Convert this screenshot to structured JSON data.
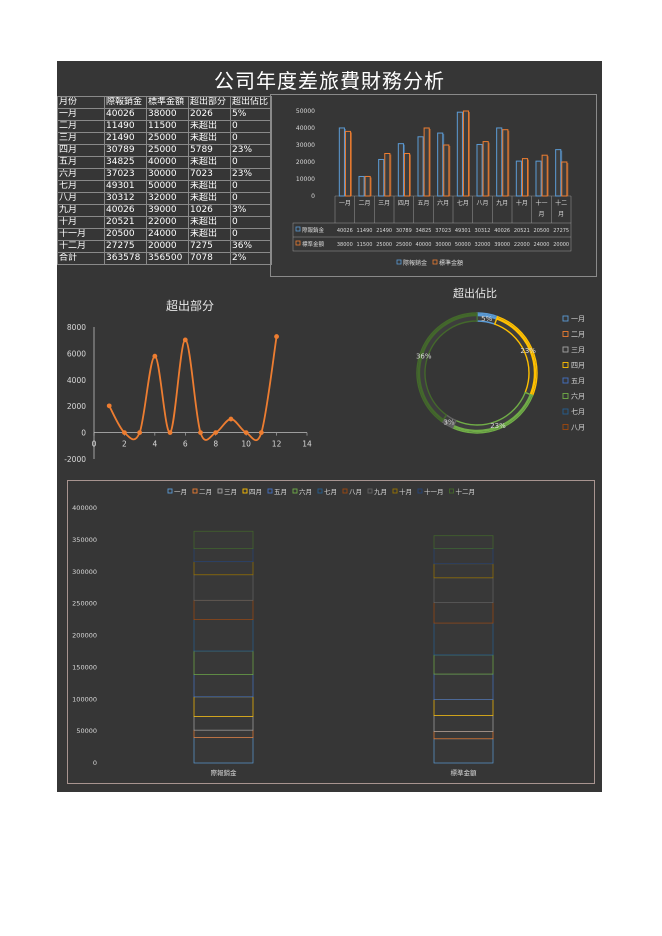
{
  "title": "公司年度差旅費財務分析",
  "table": {
    "headers": [
      "月份",
      "際報銷金",
      "標準金額",
      "超出部分",
      "超出佔比"
    ],
    "rows": [
      [
        "一月",
        "40026",
        "38000",
        "2026",
        "5%"
      ],
      [
        "二月",
        "11490",
        "11500",
        "未超出",
        "0"
      ],
      [
        "三月",
        "21490",
        "25000",
        "未超出",
        "0"
      ],
      [
        "四月",
        "30789",
        "25000",
        "5789",
        "23%"
      ],
      [
        "五月",
        "34825",
        "40000",
        "未超出",
        "0"
      ],
      [
        "六月",
        "37023",
        "30000",
        "7023",
        "23%"
      ],
      [
        "七月",
        "49301",
        "50000",
        "未超出",
        "0"
      ],
      [
        "八月",
        "30312",
        "32000",
        "未超出",
        "0"
      ],
      [
        "九月",
        "40026",
        "39000",
        "1026",
        "3%"
      ],
      [
        "十月",
        "20521",
        "22000",
        "未超出",
        "0"
      ],
      [
        "十一月",
        "20500",
        "24000",
        "未超出",
        "0"
      ],
      [
        "十二月",
        "27275",
        "20000",
        "7275",
        "36%"
      ],
      [
        "合計",
        "363578",
        "356500",
        "7078",
        "2%"
      ]
    ]
  },
  "colors": {
    "blue": "#5b9bd5",
    "orange": "#ed7d31",
    "gray": "#a5a5a5",
    "gold": "#ffc000",
    "green": "#70ad47",
    "sheet": "#363636",
    "text": "#d9d9d9"
  },
  "chart_data": [
    {
      "type": "bar",
      "categories": [
        "一月",
        "二月",
        "三月",
        "四月",
        "五月",
        "六月",
        "七月",
        "八月",
        "九月",
        "十月",
        "十一月",
        "十二月"
      ],
      "category_lines": [
        [
          "一月"
        ],
        [
          "二月"
        ],
        [
          "三月"
        ],
        [
          "四月"
        ],
        [
          "五月"
        ],
        [
          "六月"
        ],
        [
          "七月"
        ],
        [
          "八月"
        ],
        [
          "九月"
        ],
        [
          "十月"
        ],
        [
          "十一",
          "月"
        ],
        [
          "十二",
          "月"
        ]
      ],
      "series": [
        {
          "name": "際報銷金",
          "values": [
            40026,
            11490,
            21490,
            30789,
            34825,
            37023,
            49301,
            30312,
            40026,
            20521,
            20500,
            27275
          ],
          "color": "#5b9bd5"
        },
        {
          "name": "標準金額",
          "values": [
            38000,
            11500,
            25000,
            25000,
            40000,
            30000,
            50000,
            32000,
            39000,
            22000,
            24000,
            20000
          ],
          "color": "#ed7d31"
        }
      ],
      "data_table": [
        [
          "40026",
          "11490",
          "21490",
          "30789",
          "34825",
          "37023",
          "49301",
          "30312",
          "40026",
          "20521",
          "20500",
          "27275"
        ],
        [
          "38000",
          "11500",
          "25000",
          "25000",
          "40000",
          "30000",
          "50000",
          "32000",
          "39000",
          "22000",
          "24000",
          "20000"
        ]
      ],
      "yticks": [
        "0",
        "10000",
        "20000",
        "30000",
        "40000",
        "50000"
      ],
      "ylim": [
        0,
        50000
      ],
      "legend": "bottom",
      "legend_labels": [
        "際報銷金",
        "標準金額"
      ]
    },
    {
      "type": "line",
      "title": "超出部分",
      "x": [
        1,
        2,
        3,
        4,
        5,
        6,
        7,
        8,
        9,
        10,
        11,
        12
      ],
      "y": [
        2026,
        0,
        0,
        5789,
        0,
        7023,
        0,
        0,
        1026,
        0,
        0,
        7275
      ],
      "xticks": [
        "0",
        "2",
        "4",
        "6",
        "8",
        "10",
        "12",
        "14"
      ],
      "yticks": [
        "-2000",
        "0",
        "2000",
        "4000",
        "6000",
        "8000"
      ],
      "xlim": [
        0,
        14
      ],
      "ylim": [
        -2000,
        8000
      ],
      "color": "#ed7d31",
      "smooth": true
    },
    {
      "type": "pie",
      "title": "超出佔比",
      "style": "doughnut",
      "labels": [
        "一月",
        "二月",
        "三月",
        "四月",
        "五月",
        "六月",
        "七月",
        "八月",
        "九月",
        "十月",
        "十一月",
        "十二月"
      ],
      "values": [
        5,
        0,
        0,
        23,
        0,
        23,
        0,
        0,
        3,
        0,
        0,
        36
      ],
      "data_labels": [
        "5%",
        "23%",
        "23%",
        "3%",
        "36%"
      ],
      "colors": [
        "#5b9bd5",
        "#ed7d31",
        "#a5a5a5",
        "#ffc000",
        "#4472c4",
        "#70ad47",
        "#255e91",
        "#9e480e",
        "#636363",
        "#997300",
        "#264478",
        "#43682b"
      ],
      "legend": "right",
      "legend_visible": [
        "一月",
        "二月",
        "三月",
        "四月",
        "五月",
        "六月",
        "七月",
        "八月"
      ]
    },
    {
      "type": "bar",
      "style": "stacked",
      "categories": [
        "際報銷金",
        "標準金額"
      ],
      "series": [
        {
          "name": "一月",
          "values": [
            40026,
            38000
          ]
        },
        {
          "name": "二月",
          "values": [
            11490,
            11500
          ]
        },
        {
          "name": "三月",
          "values": [
            21490,
            25000
          ]
        },
        {
          "name": "四月",
          "values": [
            30789,
            25000
          ]
        },
        {
          "name": "五月",
          "values": [
            34825,
            40000
          ]
        },
        {
          "name": "六月",
          "values": [
            37023,
            30000
          ]
        },
        {
          "name": "七月",
          "values": [
            49301,
            50000
          ]
        },
        {
          "name": "八月",
          "values": [
            30312,
            32000
          ]
        },
        {
          "name": "九月",
          "values": [
            40026,
            39000
          ]
        },
        {
          "name": "十月",
          "values": [
            20521,
            22000
          ]
        },
        {
          "name": "十一月",
          "values": [
            20500,
            24000
          ]
        },
        {
          "name": "十二月",
          "values": [
            27275,
            20000
          ]
        }
      ],
      "colors": [
        "#5b9bd5",
        "#ed7d31",
        "#a5a5a5",
        "#ffc000",
        "#4472c4",
        "#70ad47",
        "#255e91",
        "#9e480e",
        "#636363",
        "#997300",
        "#264478",
        "#43682b"
      ],
      "yticks": [
        "0",
        "50000",
        "100000",
        "150000",
        "200000",
        "250000",
        "300000",
        "350000",
        "400000"
      ],
      "ylim": [
        0,
        400000
      ],
      "legend": "top"
    }
  ]
}
